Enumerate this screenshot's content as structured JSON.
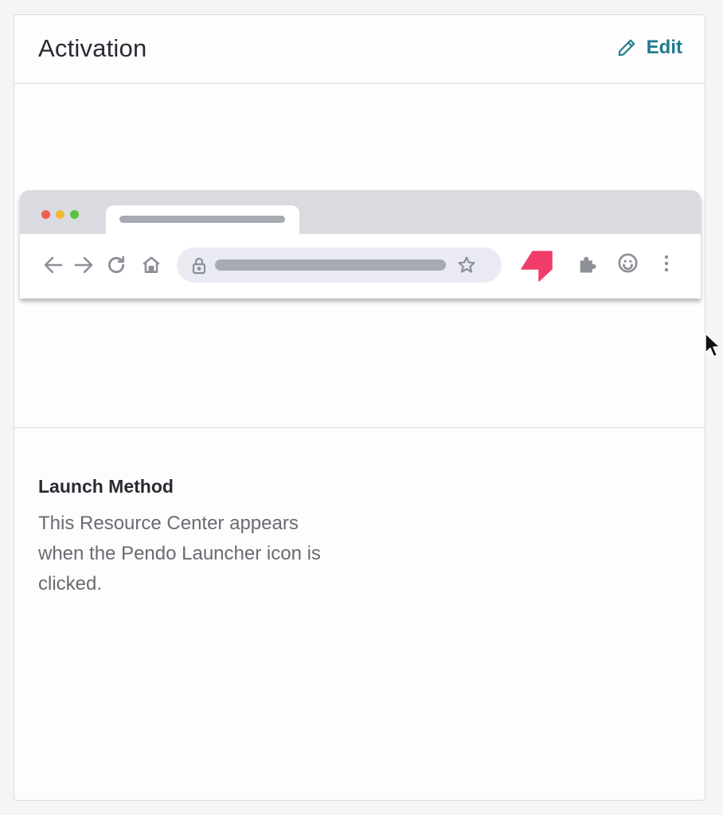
{
  "header": {
    "title": "Activation",
    "edit_label": "Edit"
  },
  "preview": {
    "traffic_light_colors": [
      "#ec5f57",
      "#f0b93a",
      "#5cc244"
    ],
    "launcher_color": "#f23d6b",
    "icons": [
      "back-arrow-icon",
      "forward-arrow-icon",
      "reload-icon",
      "home-icon",
      "lock-icon",
      "star-icon",
      "pendo-launcher-icon",
      "puzzle-icon",
      "smiley-icon",
      "more-vertical-icon",
      "mouse-cursor-icon"
    ]
  },
  "launch_method": {
    "title": "Launch Method",
    "description": "This Resource Center appears when the Pendo Launcher icon is clicked."
  },
  "colors": {
    "accent": "#1e7a8c",
    "title_text": "#2a2a33",
    "body_text": "#6a6a72"
  }
}
